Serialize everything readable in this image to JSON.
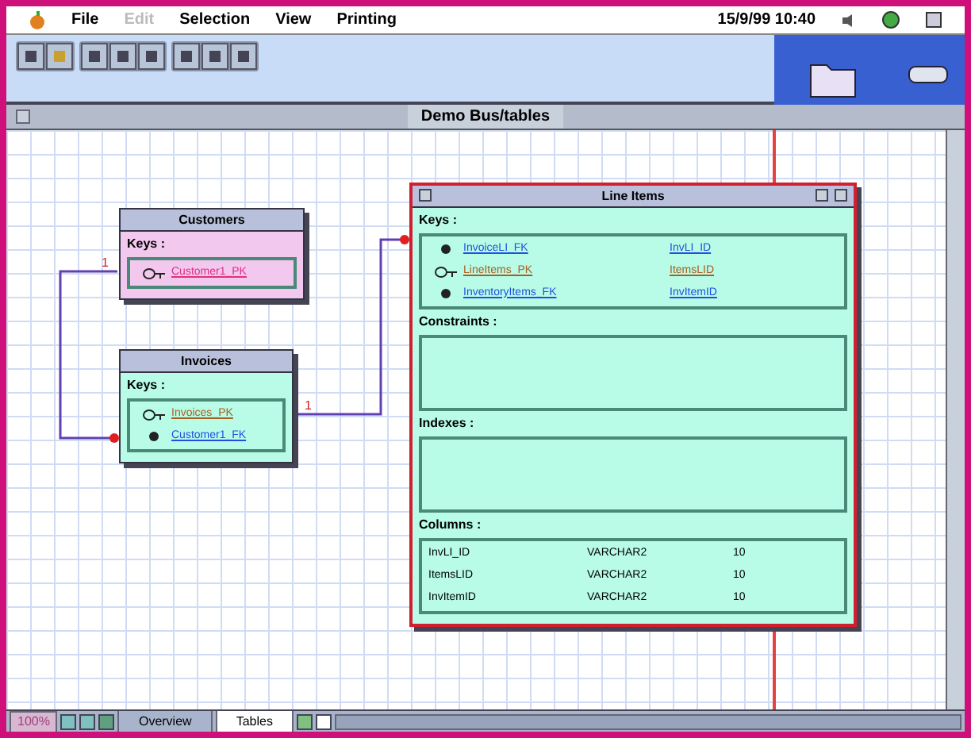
{
  "menu": [
    {
      "label": "File",
      "disabled": false
    },
    {
      "label": "Edit",
      "disabled": true
    },
    {
      "label": "Selection",
      "disabled": false
    },
    {
      "label": "View",
      "disabled": false
    },
    {
      "label": "Printing",
      "disabled": false
    }
  ],
  "clock": "15/9/99 10:40",
  "window": {
    "title": "Demo Bus/tables"
  },
  "tables": [
    {
      "title": "Customers",
      "color": "#f2c8ee",
      "sections": [
        {
          "label": "Keys :",
          "kind": "keys",
          "rows": [
            {
              "kind": "key",
              "color": "#e03080",
              "name": "Customer1_PK"
            }
          ]
        }
      ]
    },
    {
      "title": "Invoices",
      "color": "#b8fce8",
      "sections": [
        {
          "label": "Keys :",
          "kind": "keys",
          "rows": [
            {
              "kind": "key",
              "color": "#a86020",
              "name": "Invoices_PK"
            },
            {
              "kind": "dot",
              "color": "#2050e0",
              "name": "Customer1_FK"
            }
          ]
        }
      ]
    },
    {
      "title": "Line Items",
      "color": "#b8fce8",
      "sections": [
        {
          "label": "Keys :",
          "kind": "keys",
          "rows": [
            {
              "kind": "dot",
              "color": "#2050e0",
              "name": "InvoiceLI_FK",
              "ref": "InvLI_ID"
            },
            {
              "kind": "key",
              "color": "#a86020",
              "name": "LineItems_PK",
              "ref": "ItemsLID"
            },
            {
              "kind": "dot",
              "color": "#2050e0",
              "name": "InventoryItems_FK",
              "ref": "InvItemID"
            }
          ]
        },
        {
          "label": "Constraints :",
          "kind": "empty"
        },
        {
          "label": "Indexes :",
          "kind": "empty"
        },
        {
          "label": "Columns :",
          "kind": "columns",
          "rows": [
            {
              "name": "InvLI_ID",
              "type": "VARCHAR2",
              "size": "10"
            },
            {
              "name": "ItemsLID",
              "type": "VARCHAR2",
              "size": "10"
            },
            {
              "name": "InvItemID",
              "type": "VARCHAR2",
              "size": "10"
            }
          ]
        }
      ]
    }
  ],
  "links": [
    {
      "label": "1"
    },
    {
      "label": "1"
    }
  ],
  "zoom": "100%",
  "tabs": [
    {
      "label": "Overview",
      "selected": false
    },
    {
      "label": "Tables",
      "selected": true
    }
  ]
}
